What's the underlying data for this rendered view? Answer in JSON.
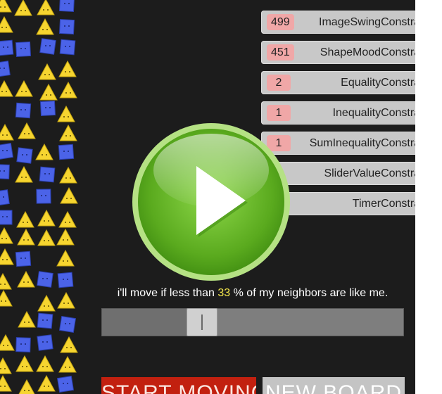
{
  "constraints": [
    {
      "count": "499",
      "name": "ImageSwingConstraint"
    },
    {
      "count": "451",
      "name": "ShapeMoodConstraint"
    },
    {
      "count": "2",
      "name": "EqualityConstraint"
    },
    {
      "count": "1",
      "name": "InequalityConstraint"
    },
    {
      "count": "1",
      "name": "SumInequalityConstraint"
    },
    {
      "count": "",
      "name": "SliderValueConstraint"
    },
    {
      "count": "",
      "name": "TimerConstraint"
    }
  ],
  "threshold": {
    "prefix": "i'll move if less than",
    "value": "33",
    "suffix": "%  of my neighbors are like me.",
    "fraction": 0.33
  },
  "buttons": {
    "start": "START MOVING",
    "new_board": "NEW BOARD"
  },
  "colors": {
    "triangle": "#f6d530",
    "square": "#4b63e8",
    "start": "#c2200f",
    "play": "#6cbf2c"
  },
  "icons": {
    "play": "play-icon",
    "triangle": "triangle-shape-icon",
    "square": "square-shape-icon"
  }
}
